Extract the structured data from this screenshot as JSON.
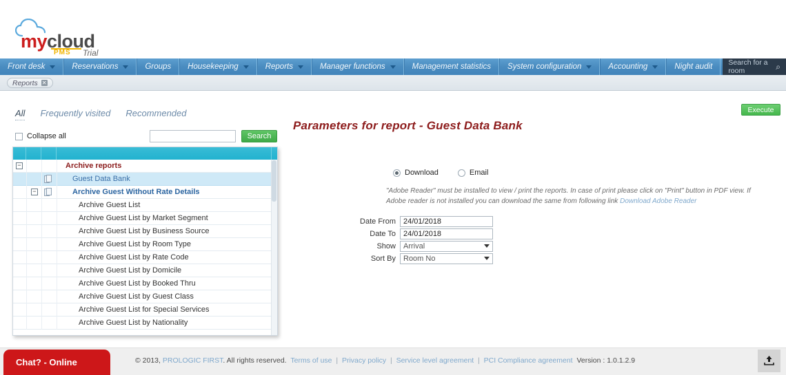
{
  "brand": {
    "logo_my": "my",
    "logo_cloud": "cloud",
    "logo_pms": "PMS",
    "trial_label": "Trial",
    "cloud_icon": "cloud-icon"
  },
  "topnav": {
    "items": [
      {
        "label": "Front desk",
        "caret": true
      },
      {
        "label": "Reservations",
        "caret": true
      },
      {
        "label": "Groups",
        "caret": false
      },
      {
        "label": "Housekeeping",
        "caret": true
      },
      {
        "label": "Reports",
        "caret": true
      },
      {
        "label": "Manager functions",
        "caret": true
      },
      {
        "label": "Management statistics",
        "caret": false
      },
      {
        "label": "System configuration",
        "caret": true
      },
      {
        "label": "Accounting",
        "caret": true
      },
      {
        "label": "Night audit",
        "caret": false
      }
    ],
    "search_placeholder": "Search for a room",
    "search_icon": "magnifier-icon"
  },
  "tabstrip": {
    "open_tab": "Reports",
    "close_glyph": "✕"
  },
  "toolbar": {
    "execute_label": "Execute"
  },
  "subtabs": [
    {
      "label": "All",
      "active": true
    },
    {
      "label": "Frequently visited",
      "active": false
    },
    {
      "label": "Recommended",
      "active": false
    }
  ],
  "tools": {
    "collapse_all_label": "Collapse all",
    "search_value": "",
    "search_placeholder": "",
    "search_button": "Search"
  },
  "tree": {
    "rows": [
      {
        "label": "Archive reports",
        "style": "root",
        "expander": "−",
        "doc": false,
        "selected": false
      },
      {
        "label": "Guest Data Bank",
        "style": "leafsel",
        "expander": "",
        "doc": true,
        "selected": true
      },
      {
        "label": "Archive Guest Without Rate Details",
        "style": "node",
        "expander": "−",
        "doc": true,
        "selected": false
      },
      {
        "label": "Archive Guest List",
        "style": "leaf",
        "expander": "",
        "doc": false,
        "selected": false
      },
      {
        "label": "Archive Guest List by Market Segment",
        "style": "leaf",
        "expander": "",
        "doc": false,
        "selected": false
      },
      {
        "label": "Archive Guest List by Business Source",
        "style": "leaf",
        "expander": "",
        "doc": false,
        "selected": false
      },
      {
        "label": "Archive Guest List by Room Type",
        "style": "leaf",
        "expander": "",
        "doc": false,
        "selected": false
      },
      {
        "label": "Archive Guest List by Rate Code",
        "style": "leaf",
        "expander": "",
        "doc": false,
        "selected": false
      },
      {
        "label": "Archive Guest List by Domicile",
        "style": "leaf",
        "expander": "",
        "doc": false,
        "selected": false
      },
      {
        "label": "Archive Guest List by Booked Thru",
        "style": "leaf",
        "expander": "",
        "doc": false,
        "selected": false
      },
      {
        "label": "Archive Guest List by Guest Class",
        "style": "leaf",
        "expander": "",
        "doc": false,
        "selected": false
      },
      {
        "label": "Archive Guest List for Special Services",
        "style": "leaf",
        "expander": "",
        "doc": false,
        "selected": false
      },
      {
        "label": "Archive Guest List by Nationality",
        "style": "leaf",
        "expander": "",
        "doc": false,
        "selected": false
      }
    ]
  },
  "params": {
    "title": "Parameters for report - Guest Data Bank",
    "delivery": [
      {
        "label": "Download",
        "selected": true
      },
      {
        "label": "Email",
        "selected": false
      }
    ],
    "note_text": "\"Adobe Reader\" must be installed to view / print the reports. In case of print please click on \"Print\" button in PDF view. If Adobe reader is not installed you can download the same from following link",
    "note_link": "Download Adobe Reader",
    "fields": [
      {
        "label": "Date From",
        "value": "24/01/2018",
        "type": "text"
      },
      {
        "label": "Date To",
        "value": "24/01/2018",
        "type": "text"
      },
      {
        "label": "Show",
        "value": "Arrival",
        "type": "select"
      },
      {
        "label": "Sort By",
        "value": "Room No",
        "type": "select"
      }
    ]
  },
  "footer": {
    "copyright": "© 2013,",
    "company": "PROLOGIC FIRST",
    "rights": ". All rights reserved.",
    "links": [
      "Terms of use",
      "Privacy policy",
      "Service level agreement",
      "PCI Compliance agreement"
    ],
    "separator": "|",
    "version": "Version : 1.0.1.2.9",
    "chat_label": "Chat? - Online",
    "upload_icon": "upload-icon"
  },
  "colors": {
    "nav_blue": "#4a8cc0",
    "tree_header_cyan": "#22b2cf",
    "accent_green": "#45b74c",
    "title_maroon": "#8d1c1c",
    "chat_red": "#cd1719",
    "link_blue": "#7fa8cc"
  }
}
